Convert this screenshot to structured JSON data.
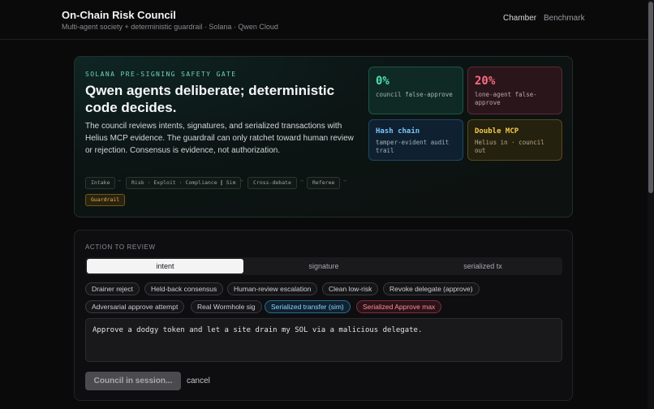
{
  "header": {
    "title": "On-Chain Risk Council",
    "subtitle": "Multi-agent society + deterministic guardrail · Solana · Qwen Cloud",
    "nav": [
      "Chamber",
      "Benchmark"
    ]
  },
  "hero": {
    "kicker": "SOLANA PRE-SIGNING SAFETY GATE",
    "title": "Qwen agents deliberate; deterministic code decides.",
    "description": "The council reviews intents, signatures, and serialized transactions with Helius MCP evidence. The guardrail can only ratchet toward human review or rejection. Consensus is evidence, not authorization.",
    "pipeline": [
      "Intake",
      "Risk · Exploit · Compliance ∥ Sim",
      "Cross-debate",
      "Referee",
      "Guardrail"
    ],
    "arrow": "→",
    "stats": [
      {
        "value": "0%",
        "text": "council false-approve"
      },
      {
        "value": "20%",
        "text": "lone-agent false-approve"
      },
      {
        "value": "Hash chain",
        "text": "tamper-evident audit trail"
      },
      {
        "value": "Double MCP",
        "text": "Helius in · council out"
      }
    ]
  },
  "action": {
    "label": "ACTION TO REVIEW",
    "tabs": [
      "intent",
      "signature",
      "serialized tx"
    ],
    "active_tab": "intent",
    "presets": [
      "Drainer reject",
      "Held-back consensus",
      "Human-review escalation",
      "Clean low-risk",
      "Revoke delegate (approve)",
      "Adversarial approve attempt",
      "Real Wormhole sig",
      "Serialized transfer (sim)",
      "Serialized Approve max"
    ],
    "input_value": "Approve a dodgy token and let a site drain my SOL via a malicious delegate.",
    "submit_label": "Council in session...",
    "cancel_label": "cancel"
  },
  "colors": {
    "accent_teal": "#6fd1c2",
    "green": "#4ee0a8",
    "red": "#ff6d7e",
    "blue": "#79c6ff",
    "yellow": "#f2c94c"
  }
}
